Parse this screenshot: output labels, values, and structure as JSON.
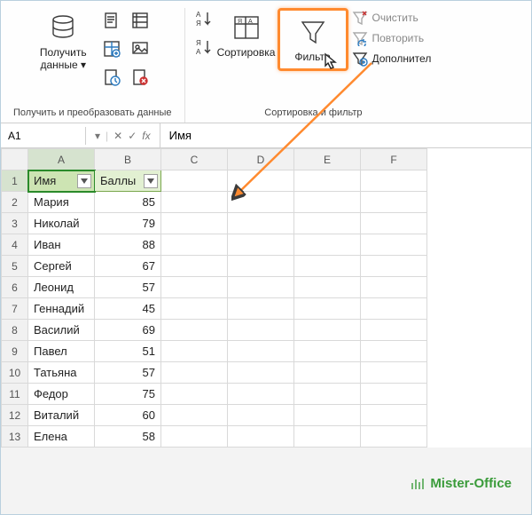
{
  "ribbon": {
    "group_getdata": {
      "label": "Получить и преобразовать данные",
      "getdata_label": "Получить данные",
      "mini": [
        "from-text-icon",
        "from-web-icon",
        "from-table-icon",
        "from-db-icon",
        "recent-icon",
        "exist-conn-icon"
      ]
    },
    "group_sort": {
      "label": "Сортировка и фильтр",
      "sort_asc_label": "A→Я",
      "sort_desc_label": "Я→A",
      "sort_btn_label": "Сортировка",
      "filter_btn_label": "Фильтр",
      "clear_label": "Очистить",
      "reapply_label": "Повторить",
      "advanced_label": "Дополнител"
    }
  },
  "formula": {
    "namebox": "A1",
    "fx": "fx",
    "value": "Имя"
  },
  "chart_data": {
    "type": "table",
    "columns": [
      "Имя",
      "Баллы"
    ],
    "rows": [
      [
        "Мария",
        85
      ],
      [
        "Николай",
        79
      ],
      [
        "Иван",
        88
      ],
      [
        "Сергей",
        67
      ],
      [
        "Леонид",
        57
      ],
      [
        "Геннадий",
        45
      ],
      [
        "Василий",
        69
      ],
      [
        "Павел",
        51
      ],
      [
        "Татьяна",
        57
      ],
      [
        "Федор",
        75
      ],
      [
        "Виталий",
        60
      ],
      [
        "Елена",
        58
      ]
    ]
  },
  "grid": {
    "col_headers": [
      "A",
      "B",
      "C",
      "D",
      "E",
      "F"
    ],
    "header_row": {
      "A": "Имя",
      "B": "Баллы"
    }
  },
  "watermark": "Mister-Office"
}
